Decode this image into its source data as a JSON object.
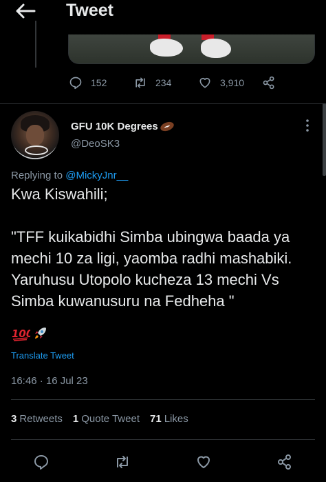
{
  "header": {
    "title": "Tweet",
    "back_icon": "arrow-left-icon"
  },
  "parent_tweet": {
    "stats": {
      "replies": "152",
      "retweets": "234",
      "likes": "3,910"
    }
  },
  "tweet": {
    "author_name": "GFU 10K Degrees",
    "author_name_emoji": "football-emoji",
    "handle": "@DeoSK3",
    "replying_prefix": "Replying to ",
    "replying_to": "@MickyJnr__",
    "text": "Kwa Kiswahili;\n\n\"TFF kuikabidhi Simba ubingwa baada ya mechi 10 za ligi, yaomba radhi mashabiki. Yaruhusu Utopolo kucheza 13 mechi Vs Simba kuwanusuru na Fedheha \"",
    "emojis": [
      "hundred-points-emoji",
      "rocket-emoji"
    ],
    "translate_label": "Translate Tweet",
    "timestamp": "16:46 · 16 Jul 23",
    "stats": {
      "retweets_count": "3",
      "retweets_label": "Retweets",
      "quotes_count": "1",
      "quotes_label": "Quote Tweet",
      "likes_count": "71",
      "likes_label": "Likes"
    }
  },
  "colors": {
    "background": "#000000",
    "text": "#e7e9ea",
    "muted": "#8b98a5",
    "link": "#1d9bf0",
    "divider": "#2f3336"
  }
}
